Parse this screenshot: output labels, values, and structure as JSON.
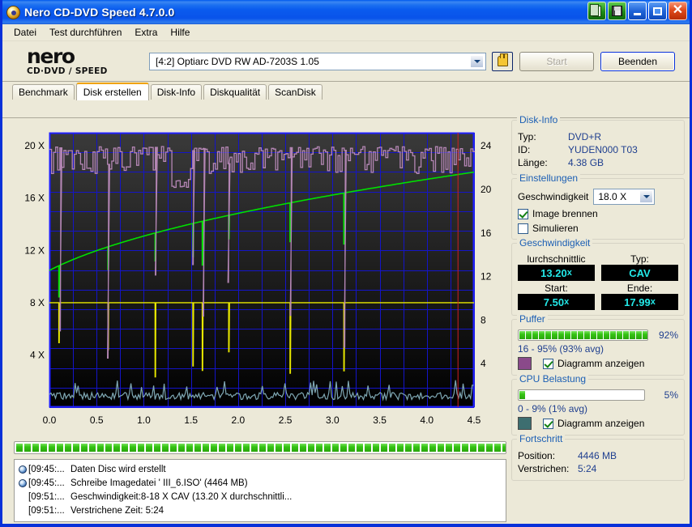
{
  "window": {
    "title": "Nero CD-DVD Speed 4.7.0.0",
    "icons": {
      "app": "nero-disc-icon",
      "copy": "copy-document-icon",
      "save": "save-floppy-icon",
      "minimize": "minimize-icon",
      "maximize": "maximize-icon",
      "close": "close-icon"
    }
  },
  "menu": {
    "items": [
      "Datei",
      "Test durchführen",
      "Extra",
      "Hilfe"
    ]
  },
  "toolbar": {
    "logo_word": "nero",
    "logo_sub": "CD·DVD ∕ SPEED",
    "drive": "[4:2]   Optiarc DVD RW AD-7203S 1.05",
    "refresh_icon": "hand-eject-icon",
    "start_label": "Start",
    "start_enabled": false,
    "quit_label": "Beenden"
  },
  "tabs": [
    {
      "label": "Benchmark",
      "active": false
    },
    {
      "label": "Disk erstellen",
      "active": true
    },
    {
      "label": "Disk-Info",
      "active": false
    },
    {
      "label": "Diskqualität",
      "active": false
    },
    {
      "label": "ScanDisk",
      "active": false
    }
  ],
  "chart_data": {
    "type": "line",
    "title": "",
    "xlabel": "",
    "ylabel": "",
    "x": [
      0.0,
      0.5,
      1.0,
      1.5,
      2.0,
      2.5,
      3.0,
      3.5,
      4.0,
      4.5
    ],
    "xlim": [
      0.0,
      4.5
    ],
    "xticks": [
      "0.0",
      "0.5",
      "1.0",
      "1.5",
      "2.0",
      "2.5",
      "3.0",
      "3.5",
      "4.0",
      "4.5"
    ],
    "y_left_ticks": [
      "4 X",
      "8 X",
      "12 X",
      "16 X",
      "20 X"
    ],
    "y_left_values": [
      4,
      8,
      12,
      16,
      20
    ],
    "ylim_left": [
      0,
      21
    ],
    "y_right_ticks": [
      "4",
      "8",
      "12",
      "16",
      "20",
      "24"
    ],
    "y_right_values": [
      4,
      8,
      12,
      16,
      20,
      24
    ],
    "ylim_right": [
      0,
      25.2
    ],
    "grid": true,
    "legend": "none",
    "background": "#262626",
    "gridcolor": "#1414c8",
    "series": [
      {
        "name": "write-speed",
        "color": "#00e000",
        "axis": "left",
        "note": "CAV ramp 7.5x -> 17.99x with dropout spikes",
        "points": [
          [
            0.0,
            7.5
          ],
          [
            0.25,
            8.6
          ],
          [
            0.5,
            9.55
          ],
          [
            0.75,
            10.35
          ],
          [
            1.0,
            11.1
          ],
          [
            1.25,
            11.75
          ],
          [
            1.5,
            12.4
          ],
          [
            1.75,
            13.0
          ],
          [
            2.0,
            13.55
          ],
          [
            2.25,
            14.1
          ],
          [
            2.5,
            14.6
          ],
          [
            2.75,
            15.1
          ],
          [
            3.0,
            15.55
          ],
          [
            3.25,
            16.0
          ],
          [
            3.5,
            16.45
          ],
          [
            3.75,
            16.85
          ],
          [
            4.0,
            17.25
          ],
          [
            4.25,
            17.65
          ],
          [
            4.45,
            17.99
          ]
        ],
        "dropouts": [
          0.1,
          0.62,
          1.12,
          1.52,
          1.62,
          1.9,
          2.55,
          3.12
        ]
      },
      {
        "name": "buffer-level",
        "color": "#b486b4",
        "axis": "right",
        "note": "write buffer percent, 16-95%, avg 93%",
        "baseline_pct": 93
      },
      {
        "name": "cpu-usage",
        "color": "#7fa8b4",
        "axis": "right",
        "note": "CPU load percent, 0-9%, avg 1%",
        "baseline_pct": 1
      },
      {
        "name": "read-transfer",
        "color": "#e8e800",
        "axis": "left",
        "note": "source read rate, flat near 8x",
        "baseline": 8.0
      }
    ]
  },
  "progress_strip": {
    "segments": 66,
    "filled": 66
  },
  "log": {
    "rows": [
      {
        "icon": "disc-icon",
        "time": "[09:45:...",
        "message": "Daten Disc wird erstellt"
      },
      {
        "icon": "disc-icon",
        "time": "[09:45:...",
        "message": "Schreibe Imagedatei '      III_6.ISO' (4464 MB)"
      },
      {
        "icon": "",
        "time": "[09:51:...",
        "message": "Geschwindigkeit:8-18 X CAV (13.20 X durchschnittli..."
      },
      {
        "icon": "",
        "time": "[09:51:...",
        "message": "Verstrichene Zeit: 5:24"
      }
    ]
  },
  "panels": {
    "disk_info": {
      "title": "Disk-Info",
      "rows": [
        {
          "key": "Typ:",
          "value": "DVD+R"
        },
        {
          "key": "ID:",
          "value": "YUDEN000 T03"
        },
        {
          "key": "Länge:",
          "value": "4.38 GB"
        }
      ]
    },
    "settings": {
      "title": "Einstellungen",
      "speed_label": "Geschwindigkeit",
      "speed_value": "18.0 X",
      "checkboxes": [
        {
          "label": "Image brennen",
          "checked": true
        },
        {
          "label": "Simulieren",
          "checked": false
        }
      ]
    },
    "speed": {
      "title": "Geschwindigkeit",
      "cells": [
        {
          "label": "lurchschnittlic",
          "value": "13.20",
          "suffix": "x"
        },
        {
          "label": "Typ:",
          "value": "CAV",
          "suffix": ""
        },
        {
          "label": "Start:",
          "value": "7.50",
          "suffix": "x"
        },
        {
          "label": "Ende:",
          "value": "17.99",
          "suffix": "x"
        }
      ]
    },
    "buffer": {
      "title": "Puffer",
      "percent_label": "92%",
      "fill_percent": 92,
      "range_text": "16 - 95% (93% avg)",
      "swatch_color": "#8a4a8a",
      "checkbox_label": "Diagramm anzeigen",
      "checkbox_checked": true
    },
    "cpu": {
      "title": "CPU Belastung",
      "percent_label": "5%",
      "fill_percent": 5,
      "range_text": "0 - 9% (1% avg)",
      "swatch_color": "#3d6e70",
      "checkbox_label": "Diagramm anzeigen",
      "checkbox_checked": true
    },
    "progress": {
      "title": "Fortschritt",
      "rows": [
        {
          "key": "Position:",
          "value": "4446 MB"
        },
        {
          "key": "Verstrichen:",
          "value": "5:24"
        }
      ]
    }
  }
}
